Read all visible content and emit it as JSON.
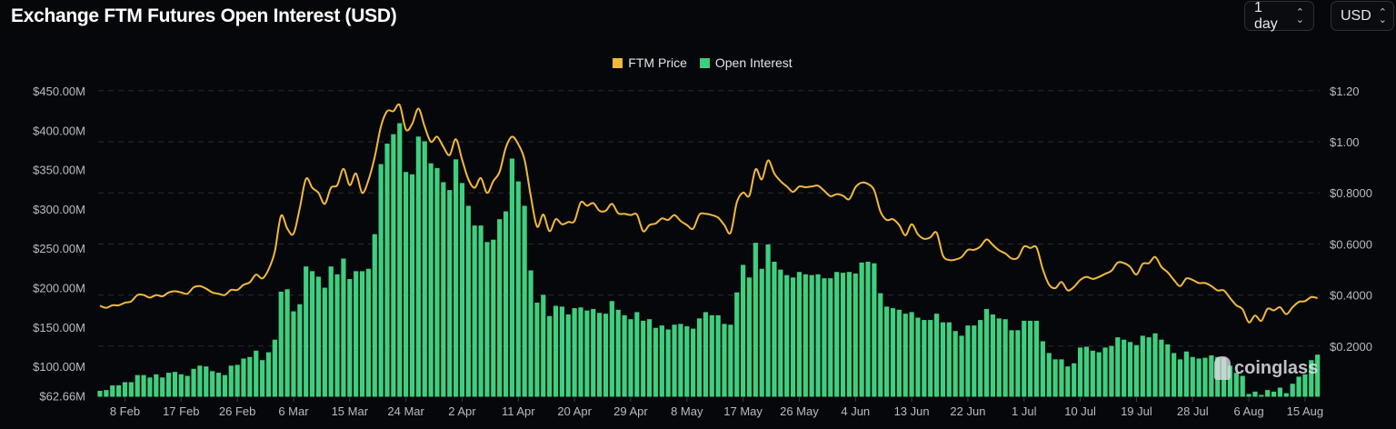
{
  "header": {
    "title": "Exchange FTM Futures Open Interest (USD)",
    "interval_select": "1 day",
    "currency_select": "USD"
  },
  "watermark": "coinglass",
  "colors": {
    "price": "#f1b93b",
    "open_interest": "#3ecf7e",
    "background": "#06070b",
    "grid": "#2a2c33"
  },
  "chart_data": {
    "type": "bar+line",
    "title": "Exchange FTM Futures Open Interest (USD)",
    "legend": [
      "FTM Price",
      "Open Interest"
    ],
    "legend_position": "top-center",
    "x_start": "4 Feb",
    "x_step": "1 day",
    "x_ticks": [
      "8 Feb",
      "17 Feb",
      "26 Feb",
      "6 Mar",
      "15 Mar",
      "24 Mar",
      "2 Apr",
      "11 Apr",
      "20 Apr",
      "29 Apr",
      "8 May",
      "17 May",
      "26 May",
      "4 Jun",
      "13 Jun",
      "22 Jun",
      "1 Jul",
      "10 Jul",
      "19 Jul",
      "28 Jul",
      "6 Aug",
      "15 Aug"
    ],
    "x_tick_day_index": [
      4,
      13,
      22,
      31,
      40,
      49,
      58,
      67,
      76,
      85,
      94,
      103,
      112,
      121,
      130,
      139,
      148,
      157,
      166,
      175,
      184,
      193
    ],
    "y_left": {
      "label": "Open Interest (USD)",
      "range": [
        62.66,
        450
      ],
      "unit": "M",
      "ticks": [
        {
          "v": 450,
          "label": "$450.00M"
        },
        {
          "v": 400,
          "label": "$400.00M"
        },
        {
          "v": 350,
          "label": "$350.00M"
        },
        {
          "v": 300,
          "label": "$300.00M"
        },
        {
          "v": 250,
          "label": "$250.00M"
        },
        {
          "v": 200,
          "label": "$200.00M"
        },
        {
          "v": 150,
          "label": "$150.00M"
        },
        {
          "v": 100,
          "label": "$100.00M"
        },
        {
          "v": 62.66,
          "label": "$62.66M"
        }
      ]
    },
    "y_right": {
      "label": "FTM Price (USD)",
      "range": [
        0,
        1.2
      ],
      "ticks": [
        {
          "v": 1.2,
          "label": "$1.20"
        },
        {
          "v": 1.0,
          "label": "$1.00"
        },
        {
          "v": 0.8,
          "label": "$0.8000"
        },
        {
          "v": 0.6,
          "label": "$0.6000"
        },
        {
          "v": 0.4,
          "label": "$0.4000"
        },
        {
          "v": 0.2,
          "label": "$0.2000"
        }
      ]
    },
    "grid": true,
    "series": [
      {
        "name": "Open Interest",
        "type": "bar",
        "axis": "left",
        "unit": "M USD",
        "values": [
          69,
          70,
          76,
          76,
          80,
          80,
          89,
          89,
          86,
          90,
          86,
          92,
          93,
          90,
          88,
          97,
          101,
          100,
          94,
          92,
          89,
          101,
          102,
          110,
          112,
          120,
          108,
          118,
          134,
          195,
          198,
          170,
          179,
          227,
          221,
          214,
          200,
          227,
          217,
          237,
          211,
          221,
          221,
          224,
          268,
          357,
          383,
          395,
          409,
          347,
          344,
          392,
          386,
          358,
          352,
          334,
          324,
          363,
          333,
          304,
          279,
          279,
          258,
          261,
          287,
          297,
          364,
          335,
          304,
          222,
          181,
          191,
          164,
          177,
          176,
          166,
          174,
          175,
          171,
          173,
          168,
          167,
          183,
          172,
          165,
          160,
          169,
          158,
          160,
          149,
          152,
          147,
          153,
          154,
          151,
          148,
          161,
          169,
          165,
          165,
          154,
          153,
          194,
          229,
          213,
          257,
          224,
          255,
          233,
          223,
          216,
          213,
          220,
          217,
          216,
          217,
          212,
          212,
          220,
          219,
          220,
          218,
          232,
          233,
          231,
          193,
          176,
          174,
          172,
          167,
          169,
          162,
          159,
          159,
          167,
          156,
          156,
          145,
          139,
          152,
          152,
          159,
          173,
          166,
          161,
          160,
          146,
          146,
          158,
          158,
          158,
          132,
          117,
          109,
          109,
          100,
          104,
          124,
          125,
          120,
          118,
          124,
          126,
          137,
          134,
          131,
          127,
          139,
          137,
          142,
          134,
          128,
          117,
          109,
          119,
          112,
          110,
          111,
          114,
          112,
          111,
          101,
          92,
          88,
          65,
          68,
          63.5,
          70,
          68,
          73,
          66,
          78,
          87,
          90,
          108,
          115
        ]
      },
      {
        "name": "FTM Price",
        "type": "line",
        "axis": "right",
        "unit": "USD",
        "values": [
          0.358,
          0.35,
          0.36,
          0.36,
          0.37,
          0.375,
          0.4,
          0.4,
          0.39,
          0.4,
          0.395,
          0.41,
          0.415,
          0.41,
          0.405,
          0.43,
          0.435,
          0.425,
          0.41,
          0.405,
          0.4,
          0.42,
          0.42,
          0.44,
          0.45,
          0.48,
          0.465,
          0.5,
          0.57,
          0.71,
          0.66,
          0.64,
          0.74,
          0.855,
          0.82,
          0.8,
          0.757,
          0.82,
          0.83,
          0.894,
          0.83,
          0.876,
          0.8,
          0.85,
          0.94,
          1.06,
          1.12,
          1.12,
          1.144,
          1.048,
          1.07,
          1.13,
          1.06,
          1.0,
          1.02,
          0.98,
          0.948,
          1.01,
          0.93,
          0.853,
          0.82,
          0.858,
          0.8,
          0.846,
          0.882,
          0.977,
          1.02,
          0.99,
          0.93,
          0.787,
          0.668,
          0.715,
          0.65,
          0.697,
          0.677,
          0.686,
          0.69,
          0.763,
          0.75,
          0.76,
          0.73,
          0.73,
          0.757,
          0.72,
          0.718,
          0.713,
          0.715,
          0.65,
          0.674,
          0.68,
          0.7,
          0.694,
          0.713,
          0.69,
          0.674,
          0.66,
          0.715,
          0.718,
          0.713,
          0.703,
          0.674,
          0.644,
          0.763,
          0.801,
          0.789,
          0.892,
          0.853,
          0.927,
          0.876,
          0.846,
          0.825,
          0.804,
          0.825,
          0.822,
          0.825,
          0.828,
          0.808,
          0.787,
          0.795,
          0.789,
          0.775,
          0.822,
          0.84,
          0.835,
          0.81,
          0.727,
          0.694,
          0.697,
          0.674,
          0.634,
          0.677,
          0.638,
          0.62,
          0.626,
          0.644,
          0.555,
          0.537,
          0.539,
          0.549,
          0.577,
          0.577,
          0.59,
          0.618,
          0.596,
          0.575,
          0.563,
          0.543,
          0.546,
          0.59,
          0.584,
          0.586,
          0.501,
          0.441,
          0.427,
          0.451,
          0.418,
          0.432,
          0.459,
          0.471,
          0.463,
          0.471,
          0.483,
          0.495,
          0.527,
          0.525,
          0.51,
          0.48,
          0.522,
          0.525,
          0.549,
          0.51,
          0.489,
          0.459,
          0.435,
          0.465,
          0.459,
          0.447,
          0.447,
          0.435,
          0.418,
          0.418,
          0.388,
          0.36,
          0.344,
          0.293,
          0.32,
          0.299,
          0.346,
          0.34,
          0.352,
          0.325,
          0.352,
          0.373,
          0.376,
          0.392,
          0.388
        ]
      }
    ]
  }
}
